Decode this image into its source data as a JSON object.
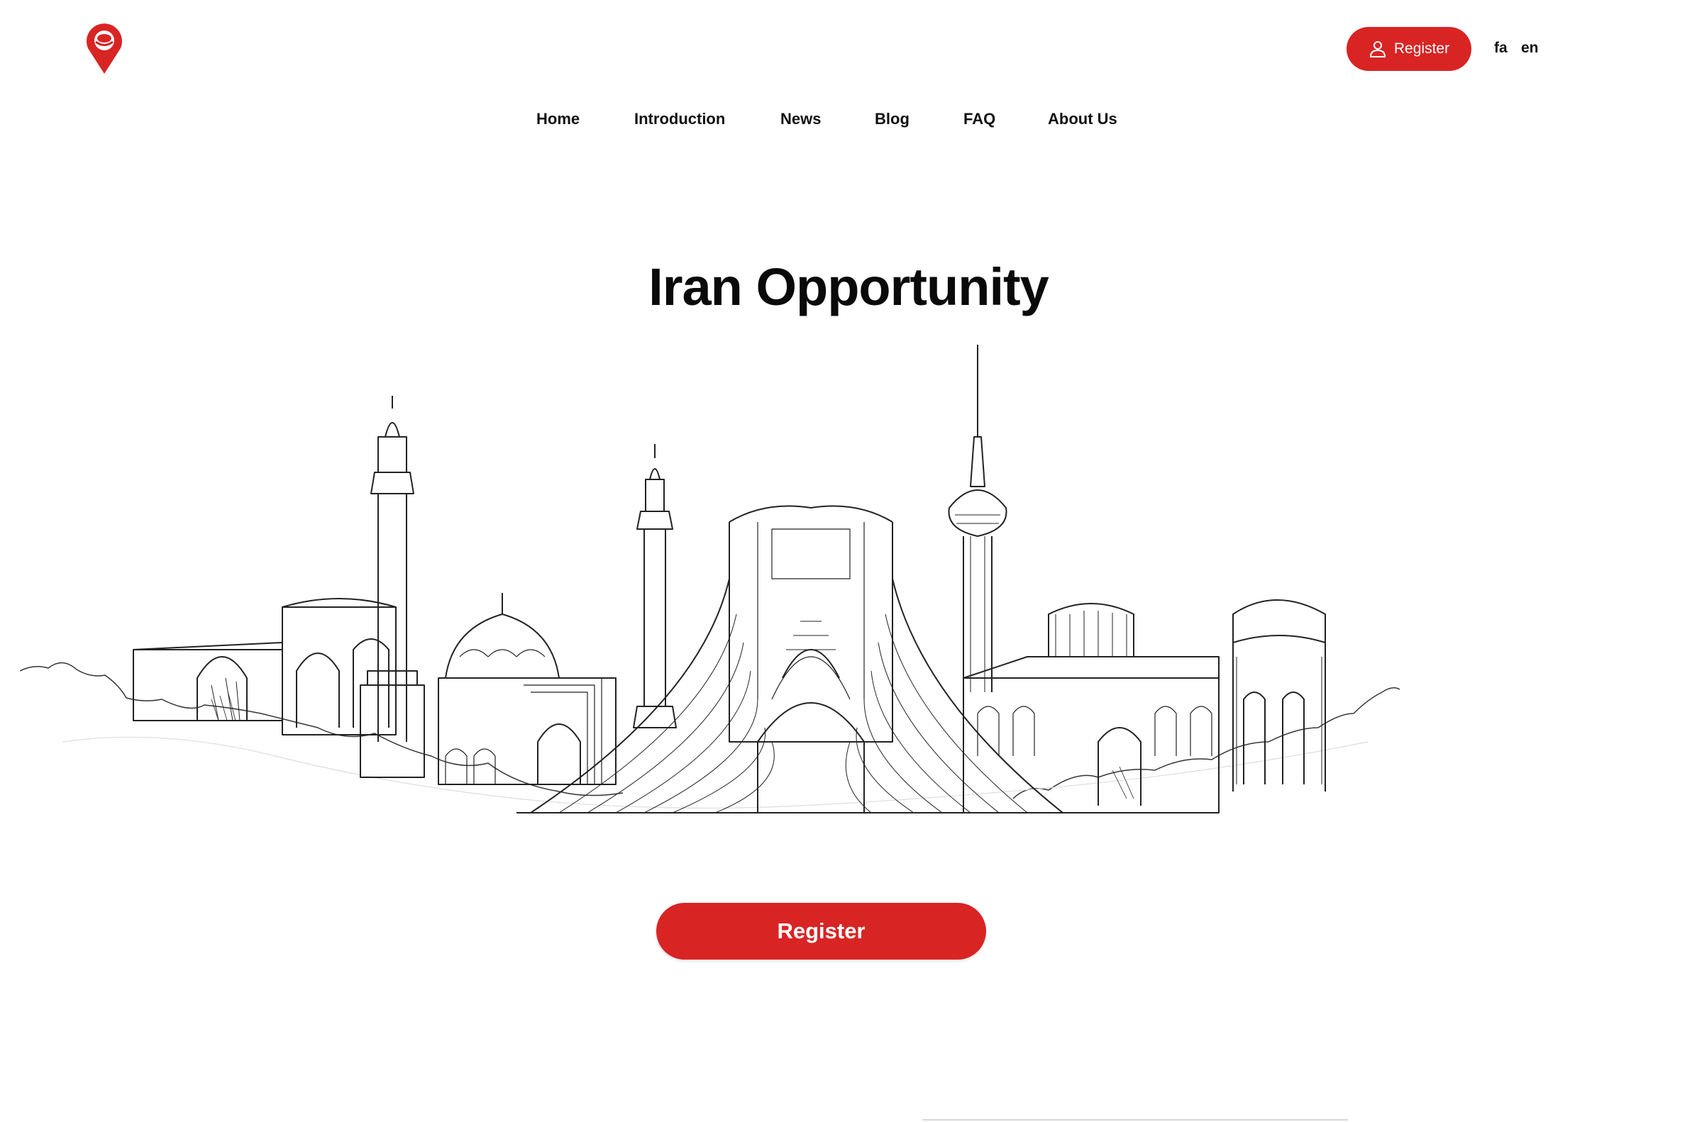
{
  "brand": {
    "logo_icon": "map-pin-icon",
    "accent_color": "#d92424"
  },
  "header": {
    "register_label": "Register",
    "register_icon": "user-icon",
    "languages": [
      "fa",
      "en"
    ]
  },
  "nav": {
    "items": [
      "Home",
      "Introduction",
      "News",
      "Blog",
      "FAQ",
      "About Us"
    ]
  },
  "hero": {
    "title": "Iran Opportunity",
    "illustration": "skyline-illustration",
    "register_label": "Register"
  }
}
